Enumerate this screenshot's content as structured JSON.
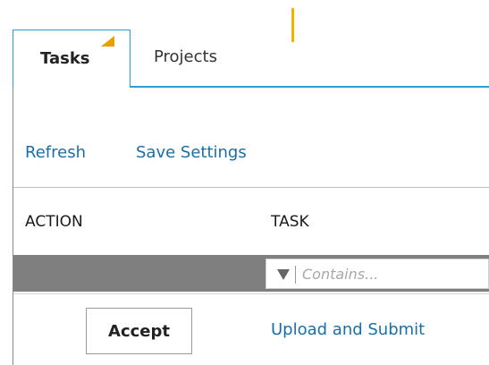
{
  "tabs": [
    {
      "label": "Tasks",
      "active": true
    },
    {
      "label": "Projects",
      "active": false
    }
  ],
  "toolbar": {
    "refresh_label": "Refresh",
    "save_settings_label": "Save Settings"
  },
  "grid": {
    "columns": [
      "ACTION",
      "TASK"
    ],
    "filter": {
      "placeholder": "Contains..."
    },
    "rows": [
      {
        "action_label": "Accept",
        "task": "Upload and Submit"
      }
    ]
  },
  "colors": {
    "accent": "#2a9fd6",
    "link": "#1a6ea8",
    "marker": "#f0b400",
    "filter_bar": "#7f7f7f"
  },
  "icons": {
    "filter": "funnel-icon",
    "tab_marker": "triangle-marker-icon"
  }
}
